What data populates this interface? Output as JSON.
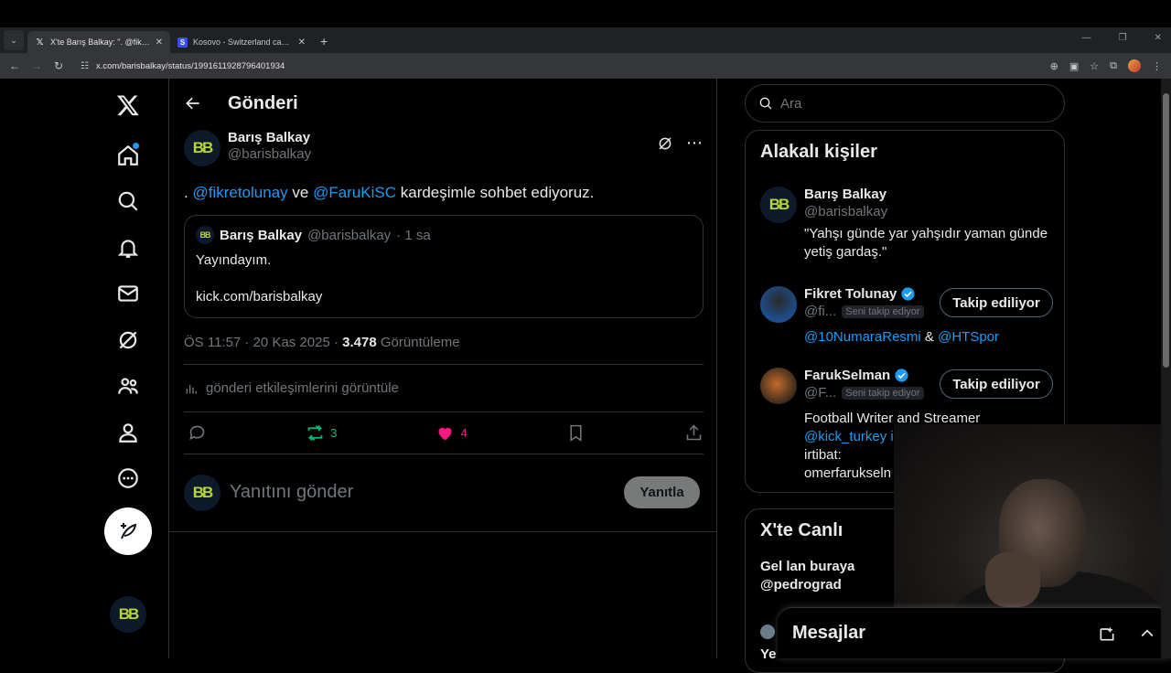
{
  "browser": {
    "tabs": [
      {
        "title": "X'te Barış Balkay: \". @fikretolun",
        "icon": "x-logo-icon",
        "active": true
      },
      {
        "title": "Kosovo - Switzerland canlı skor",
        "icon": "sofascore-icon",
        "active": false
      }
    ],
    "url": "x.com/barisbalkay/status/1991611928796401934",
    "new_tab": "+"
  },
  "page": {
    "header_title": "Gönderi",
    "nav": [
      "x-logo-icon",
      "home-icon",
      "explore-icon",
      "notifications-icon",
      "messages-icon",
      "grok-icon",
      "communities-icon",
      "profile-icon",
      "more-icon"
    ]
  },
  "post": {
    "author_name": "Barış Balkay",
    "author_handle": "@barisbalkay",
    "avatar_text": "BB",
    "text_prefix": ". ",
    "mention1": "@fikretolunay",
    "text_mid": " ve ",
    "mention2": "@FaruKiSC",
    "text_suffix": " kardeşimle sohbet ediyoruz.",
    "quote": {
      "author_name": "Barış Balkay",
      "author_handle": "@barisbalkay",
      "time": "· 1 sa",
      "line1": "Yayındayım.",
      "line2": "kick.com/barisbalkay"
    },
    "timestamp": "ÖS 11:57 · 20 Kas 2025 · ",
    "views_count": "3.478",
    "views_label": " Görüntüleme",
    "engagements": "gönderi etkileşimlerini görüntüle",
    "reposts": "3",
    "likes": "4",
    "reply_placeholder": "Yanıtını gönder",
    "reply_button": "Yanıtla"
  },
  "sidebar": {
    "search_placeholder": "Ara",
    "related_title": "Alakalı kişiler",
    "people": [
      {
        "name": "Barış Balkay",
        "handle": "@barisbalkay",
        "bio": "\"Yahşı günde yar yahşıdır yaman günde yetiş gardaş.\""
      },
      {
        "name": "Fikret Tolunay",
        "handle": "@fi...",
        "badge": "Seni takip ediyor",
        "follow": "Takip ediliyor",
        "bio_mention1": "@10NumaraResmi",
        "bio_amp": " & ",
        "bio_mention2": "@HTSpor"
      },
      {
        "name": "FarukSelman",
        "handle": "@F...",
        "badge": "Seni takip ediyor",
        "follow": "Takip ediliyor",
        "bio_line1": "Football Writer and Streamer",
        "bio_mention": "@kick_turkey i",
        "bio_line3": "irtibat:",
        "bio_line4": "omerfarukseln"
      }
    ],
    "live_title": "X'te Canlı",
    "live_item_line1": "Gel lan buraya",
    "live_item_line2": "@pedrograd",
    "live_item_partial": "Ye"
  },
  "messages_drawer": {
    "title": "Mesajlar"
  },
  "colors": {
    "accent": "#1d9bf0",
    "like": "#f91880",
    "repost": "#00ba7c",
    "border": "#2f3336",
    "muted": "#71767b"
  }
}
